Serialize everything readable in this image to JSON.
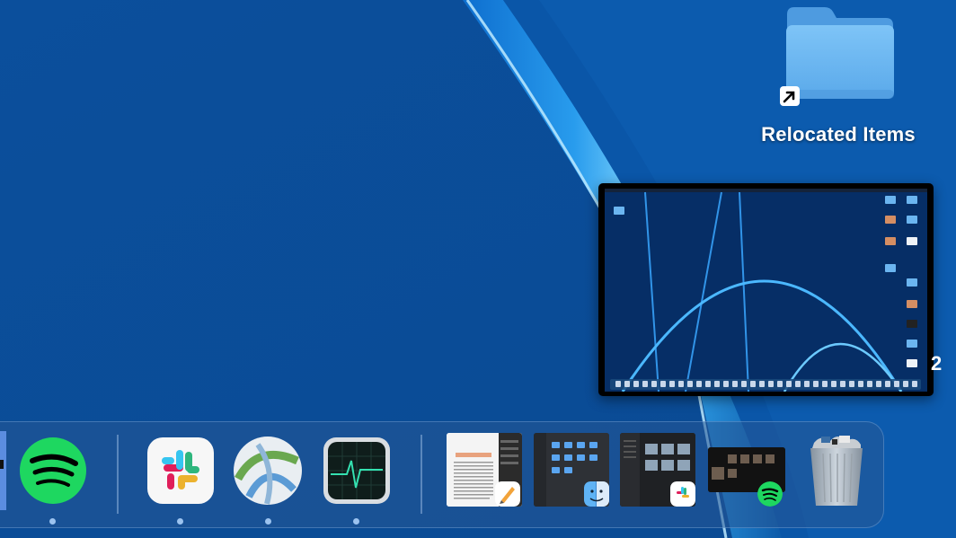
{
  "desktop": {
    "folder": {
      "label": "Relocated Items",
      "icon": "folder-icon",
      "badge_icon": "alias-arrow-icon"
    },
    "edge_glyph": "2",
    "screenshot_thumbnail": {
      "icon": "screenshot-preview"
    }
  },
  "dock": {
    "apps": [
      {
        "name": "partial-app-icon",
        "running": false
      },
      {
        "name": "spotify-icon",
        "running": true
      },
      {
        "name": "slack-icon",
        "running": true
      },
      {
        "name": "network-app-icon",
        "running": true
      },
      {
        "name": "activity-monitor-icon",
        "running": true
      }
    ],
    "recent": [
      {
        "name": "pages-document-thumbnail",
        "badge": "pages-badge-icon"
      },
      {
        "name": "finder-window-thumbnail",
        "badge": "finder-badge-icon"
      },
      {
        "name": "slack-window-thumbnail",
        "badge": "slack-badge-icon"
      },
      {
        "name": "spotify-window-thumbnail",
        "badge": "spotify-badge-icon"
      }
    ],
    "trash": {
      "name": "trash-icon",
      "state": "full"
    }
  },
  "colors": {
    "wallpaper_base": "#0a4d97",
    "wallpaper_glow": "#3fb8ff",
    "spotify_green": "#1ed760"
  }
}
